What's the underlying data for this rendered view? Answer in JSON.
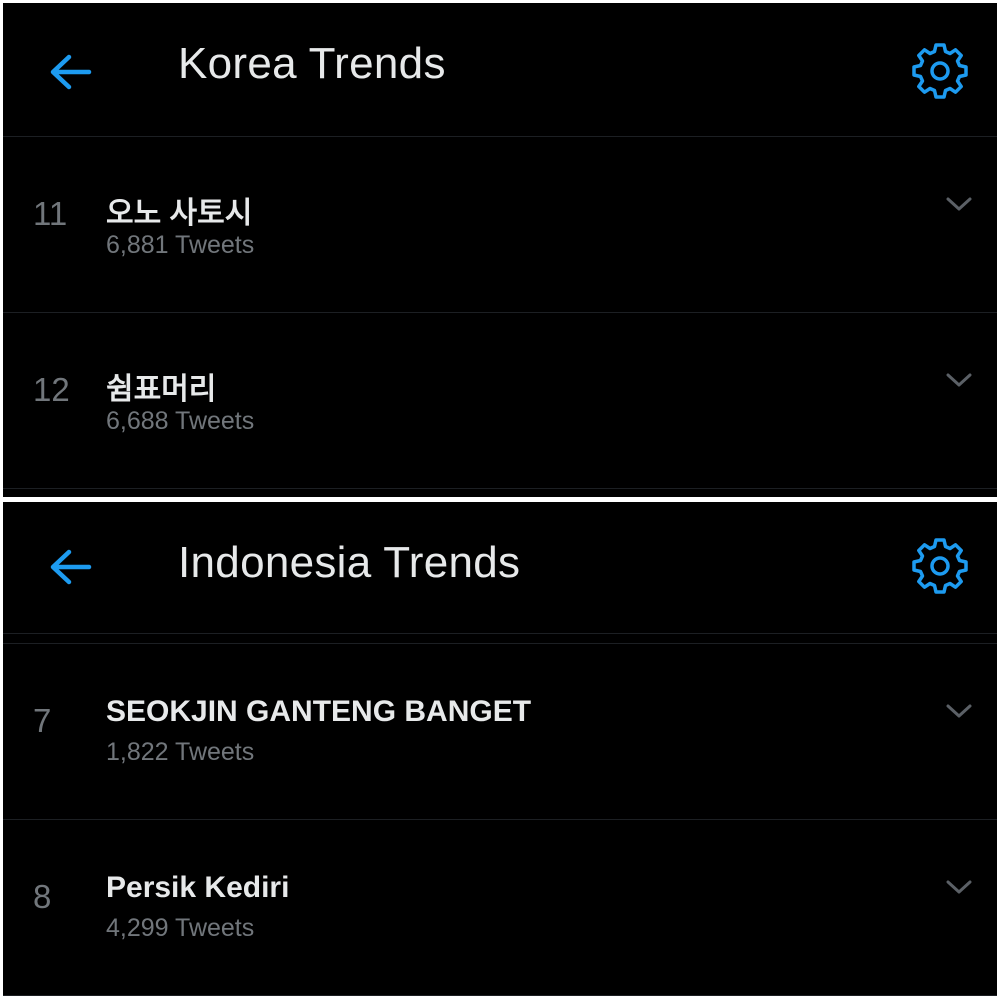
{
  "colors": {
    "background": "#000000",
    "accent": "#1d9bf0",
    "primary_text": "#e7e9ea",
    "secondary_text": "#71767b",
    "divider": "#1c1f23"
  },
  "icons": {
    "back": "arrow-left-icon",
    "settings": "gear-icon",
    "expand": "chevron-down-icon"
  },
  "korea": {
    "title": "Korea Trends",
    "trends": [
      {
        "rank": "11",
        "name": "오노 사토시",
        "tweets": "6,881 Tweets"
      },
      {
        "rank": "12",
        "name": "쉼표머리",
        "tweets": "6,688 Tweets"
      }
    ]
  },
  "indonesia": {
    "title": "Indonesia Trends",
    "trends": [
      {
        "rank": "7",
        "name": "SEOKJIN GANTENG BANGET",
        "tweets": "1,822 Tweets"
      },
      {
        "rank": "8",
        "name": "Persik Kediri",
        "tweets": "4,299 Tweets"
      }
    ]
  }
}
